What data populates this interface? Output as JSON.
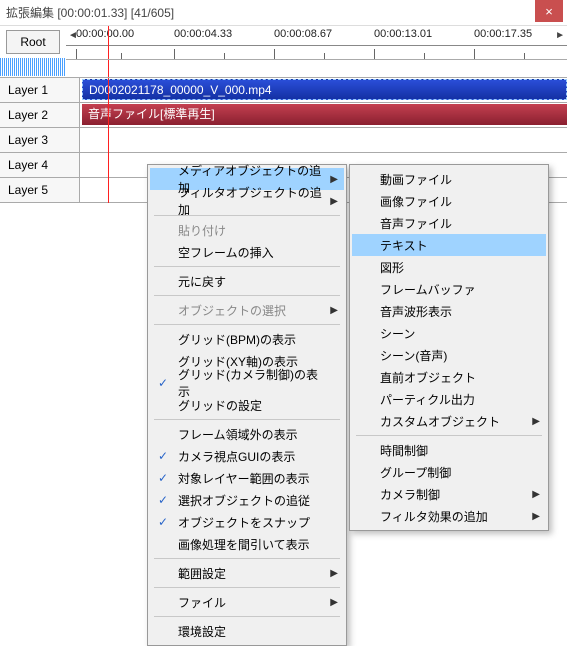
{
  "window": {
    "title": "拡張編集 [00:00:01.33] [41/605]",
    "close": "×"
  },
  "toolbar": {
    "root_label": "Root"
  },
  "timeline": {
    "labels": [
      "00:00:00.00",
      "00:00:04.33",
      "00:00:08.67",
      "00:00:13.01",
      "00:00:17.35"
    ]
  },
  "layers": [
    {
      "label": "Layer 1",
      "clip": {
        "type": "video",
        "text": "D0002021178_00000_V_000.mp4"
      }
    },
    {
      "label": "Layer 2",
      "clip": {
        "type": "audio",
        "text": "音声ファイル[標準再生]"
      }
    },
    {
      "label": "Layer 3"
    },
    {
      "label": "Layer 4"
    },
    {
      "label": "Layer 5"
    }
  ],
  "menu1": {
    "media_add": "メディアオブジェクトの追加",
    "filter_add": "フィルタオブジェクトの追加",
    "paste": "貼り付け",
    "empty_frame": "空フレームの挿入",
    "undo": "元に戻す",
    "obj_select": "オブジェクトの選択",
    "grid_bpm": "グリッド(BPM)の表示",
    "grid_xy": "グリッド(XY軸)の表示",
    "grid_cam": "グリッド(カメラ制御)の表示",
    "grid_settings": "グリッドの設定",
    "frame_out": "フレーム領域外の表示",
    "cam_gui": "カメラ視点GUIの表示",
    "layer_range": "対象レイヤー範囲の表示",
    "follow_sel": "選択オブジェクトの追従",
    "snap": "オブジェクトをスナップ",
    "thin_img": "画像処理を間引いて表示",
    "range": "範囲設定",
    "file": "ファイル",
    "env": "環境設定"
  },
  "menu2": {
    "video": "動画ファイル",
    "image": "画像ファイル",
    "audio": "音声ファイル",
    "text": "テキスト",
    "shape": "図形",
    "framebuf": "フレームバッファ",
    "waveform": "音声波形表示",
    "scene": "シーン",
    "scene_audio": "シーン(音声)",
    "prev_obj": "直前オブジェクト",
    "particle": "パーティクル出力",
    "custom": "カスタムオブジェクト",
    "time": "時間制御",
    "group": "グループ制御",
    "camera": "カメラ制御",
    "filter_fx": "フィルタ効果の追加"
  }
}
